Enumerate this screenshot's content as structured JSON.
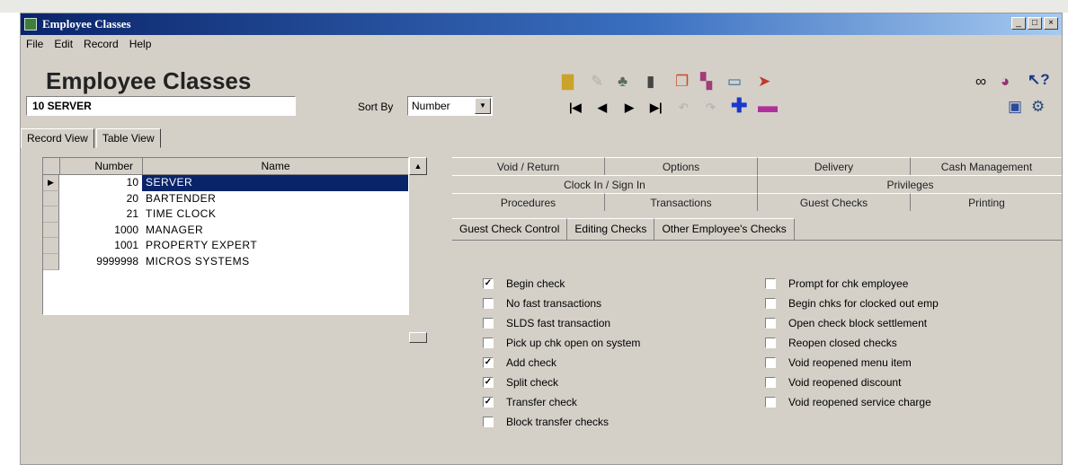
{
  "window": {
    "title": "Employee Classes"
  },
  "menu": {
    "items": [
      "File",
      "Edit",
      "Record",
      "Help"
    ]
  },
  "header": {
    "title": "Employee Classes",
    "record": "10 SERVER",
    "sort_label": "Sort By",
    "sort_value": "Number"
  },
  "view_tabs": [
    "Record View",
    "Table View"
  ],
  "grid": {
    "columns": [
      "Number",
      "Name"
    ],
    "rows": [
      {
        "number": "10",
        "name": "SERVER",
        "selected": true
      },
      {
        "number": "20",
        "name": "BARTENDER",
        "selected": false
      },
      {
        "number": "21",
        "name": "TIME CLOCK",
        "selected": false
      },
      {
        "number": "1000",
        "name": "MANAGER",
        "selected": false
      },
      {
        "number": "1001",
        "name": "PROPERTY EXPERT",
        "selected": false
      },
      {
        "number": "9999998",
        "name": "MICROS SYSTEMS",
        "selected": false
      }
    ]
  },
  "tabs": {
    "row1": [
      "Void / Return",
      "Options",
      "Delivery",
      "Cash Management"
    ],
    "row2": [
      "Clock In / Sign In",
      "Privileges"
    ],
    "row3": [
      "Procedures",
      "Transactions",
      "Guest Checks",
      "Printing"
    ],
    "active": "Guest Checks"
  },
  "subtabs": [
    "Guest Check Control",
    "Editing Checks",
    "Other Employee's Checks"
  ],
  "checks_left": [
    {
      "label": "Begin check",
      "checked": true
    },
    {
      "label": "No fast transactions",
      "checked": false
    },
    {
      "label": "SLDS fast transaction",
      "checked": false
    },
    {
      "label": "Pick up chk open on system",
      "checked": false
    },
    {
      "label": "Add check",
      "checked": true
    },
    {
      "label": "Split check",
      "checked": true
    },
    {
      "label": "Transfer check",
      "checked": true
    },
    {
      "label": "Block transfer checks",
      "checked": false
    }
  ],
  "checks_right": [
    {
      "label": "Prompt for chk employee",
      "checked": false
    },
    {
      "label": "Begin chks for clocked out emp",
      "checked": false
    },
    {
      "label": "Open check block settlement",
      "checked": false
    },
    {
      "label": "Reopen closed checks",
      "checked": false
    },
    {
      "label": "Void reopened menu item",
      "checked": false
    },
    {
      "label": "Void reopened discount",
      "checked": false
    },
    {
      "label": "Void reopened service charge",
      "checked": false
    }
  ],
  "toolbar_icons": [
    "folder-icon",
    "pencil-icon",
    "tree-icon",
    "trash-icon",
    "copy-icon",
    "report-icon",
    "screen-icon",
    "run-icon",
    "binoculars-icon",
    "paint-icon",
    "help-icon",
    "monitor-icon",
    "gear-icon"
  ],
  "nav_icons": [
    "first-icon",
    "prev-icon",
    "next-icon",
    "last-icon",
    "undo-icon",
    "redo-icon",
    "add-icon",
    "remove-icon"
  ]
}
